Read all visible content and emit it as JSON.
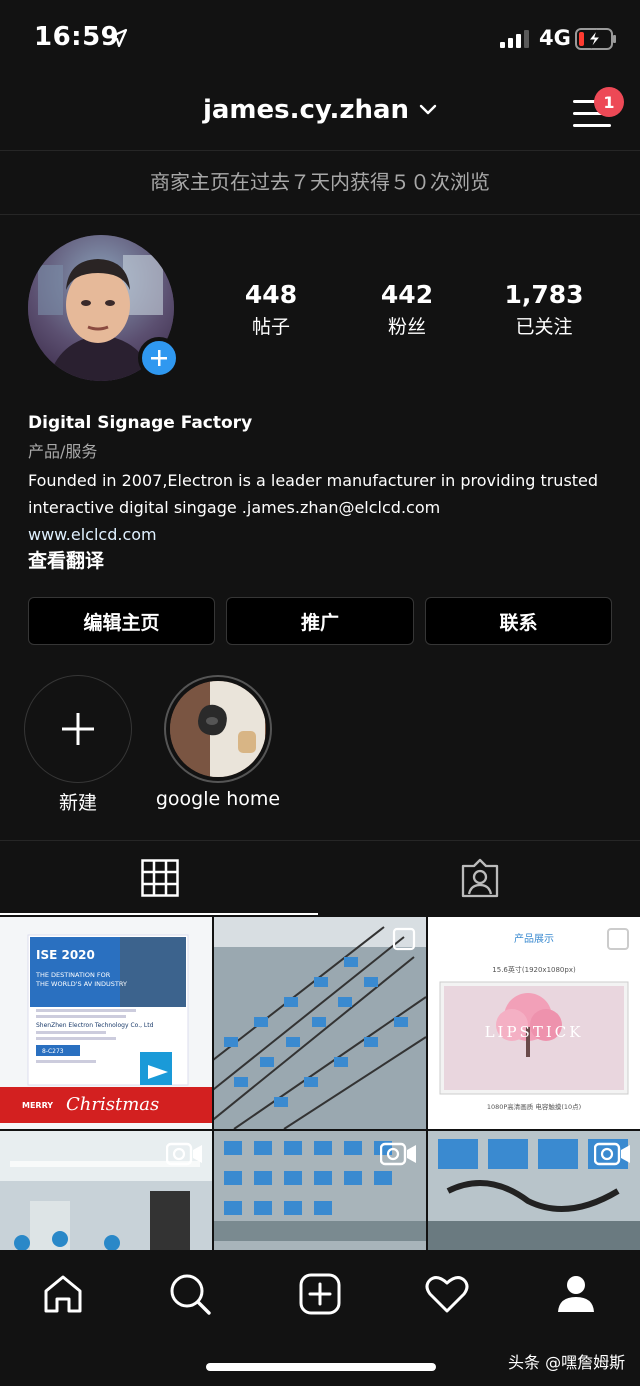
{
  "status_bar": {
    "time": "16:59",
    "network": "4G"
  },
  "header": {
    "username": "james.cy.zhan",
    "notification_count": "1"
  },
  "insights_banner": "商家主页在过去７天内获得５０次浏览",
  "stats": [
    {
      "value": "448",
      "label": "帖子"
    },
    {
      "value": "442",
      "label": "粉丝"
    },
    {
      "value": "1,783",
      "label": "已关注"
    }
  ],
  "bio": {
    "name": "Digital Signage Factory",
    "category": "产品/服务",
    "line1": "Founded in 2007,Electron is a leader manufacturer in providing trusted",
    "line2": "interactive digital singage .james.zhan@elclcd.com",
    "website": "www.elclcd.com",
    "translate": "查看翻译"
  },
  "buttons": {
    "edit": "编辑主页",
    "promote": "推广",
    "contact": "联系"
  },
  "highlights": [
    {
      "label": "新建"
    },
    {
      "label": "google home"
    }
  ],
  "posts": {
    "p1": {
      "title": "ISE 2020",
      "subtitle1": "THE DESTINATION FOR",
      "subtitle2": "THE WORLD'S AV INDUSTRY",
      "company": "ShenZhen Electron Technology Co., Ltd",
      "booth": "8-C273",
      "merry": "MERRY",
      "christmas": "Christmas"
    },
    "p3": {
      "heading": "产品展示",
      "size": "15.6英寸(1920x1080px)",
      "brand": "LIPSTICK",
      "caption": "1080P高清画质  电容触摸(10点)"
    }
  },
  "watermark": "头条 @嘿詹姆斯",
  "colors": {
    "background": "#121212",
    "badge": "#ed4956",
    "accent_blue": "#2f98f0"
  }
}
